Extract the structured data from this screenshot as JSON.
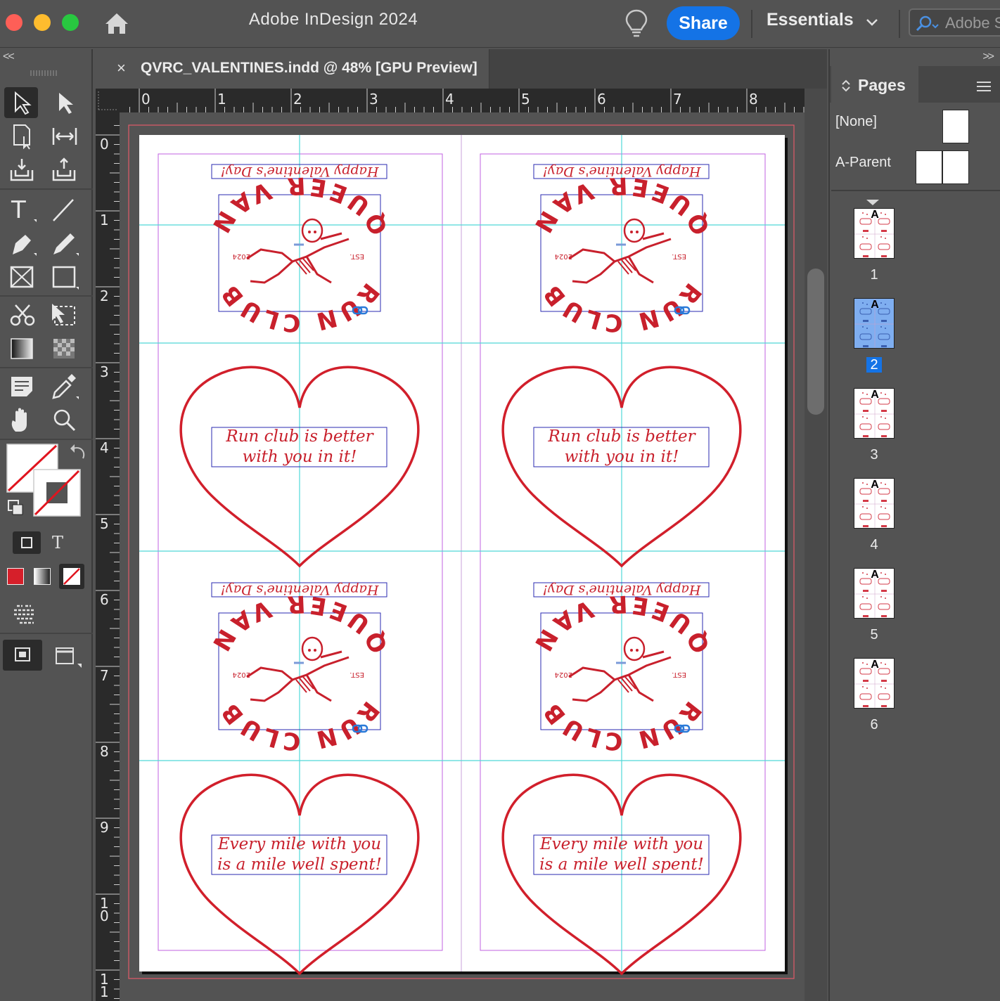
{
  "app": {
    "title": "Adobe InDesign 2024",
    "share_label": "Share",
    "workspace": "Essentials",
    "search_placeholder": "Adobe S"
  },
  "document": {
    "tab_title": "QVRC_VALENTINES.indd @ 48% [GPU Preview]",
    "tab_close": "×",
    "zoom_percent": 48
  },
  "rulers": {
    "horizontal": [
      "0",
      "1",
      "2",
      "3",
      "4",
      "5",
      "6",
      "7",
      "8"
    ],
    "vertical": [
      "0",
      "1",
      "2",
      "3",
      "4",
      "5",
      "6",
      "7",
      "8",
      "9",
      "1\n0",
      "1\n1"
    ]
  },
  "toolbar": {
    "collapse": "<<",
    "tools": [
      "selection-tool",
      "direct-selection-tool",
      "page-tool",
      "gap-tool",
      "content-collector-tool",
      "content-placer-tool",
      "type-tool",
      "line-tool",
      "pen-tool",
      "pencil-tool",
      "rectangle-frame-tool",
      "rectangle-tool",
      "scissors-tool",
      "free-transform-tool",
      "gradient-swatch-tool",
      "gradient-feather-tool",
      "note-tool",
      "eyedropper-tool",
      "hand-tool",
      "zoom-tool"
    ],
    "formatting_text_label": "T"
  },
  "cards": {
    "greeting": "Happy Valentine's Day!",
    "logo": {
      "line1": "RUN CLUB",
      "line2": "QUEER VAN",
      "est": "EST.",
      "year": "2024"
    },
    "messages": [
      {
        "line1": "Run club is better",
        "line2": "with you in it!"
      },
      {
        "line1": "Run club is better",
        "line2": "with you in it!"
      },
      {
        "line1": "Every mile with you",
        "line2": "is a mile well spent!"
      },
      {
        "line1": "Every mile with you",
        "line2": "is a mile well spent!"
      }
    ]
  },
  "pages_panel": {
    "collapse": ">>",
    "tab_label": "Pages",
    "parents": [
      {
        "label": "[None]"
      },
      {
        "label": "A-Parent"
      }
    ],
    "thumb_prefix": "A",
    "pages": [
      "1",
      "2",
      "3",
      "4",
      "5",
      "6"
    ],
    "selected_page": "2"
  },
  "colors": {
    "accent_blue": "#1473e6",
    "card_red": "#c8202c",
    "guide_cyan": "#4fd8d8",
    "margin_magenta": "#c060e0",
    "frame_blue": "#2a2ab0"
  }
}
